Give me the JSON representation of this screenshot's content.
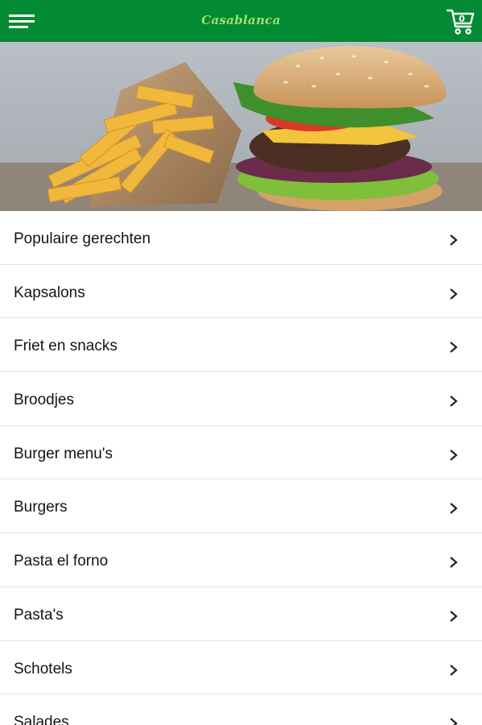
{
  "header": {
    "brand": "Casablanca",
    "cart_count": "0",
    "menu_icon": "hamburger-menu-icon",
    "cart_icon": "shopping-cart-icon"
  },
  "hero": {
    "image": "burger-and-fries-photo"
  },
  "categories": [
    {
      "label": "Populaire gerechten"
    },
    {
      "label": "Kapsalons"
    },
    {
      "label": "Friet en snacks"
    },
    {
      "label": "Broodjes"
    },
    {
      "label": "Burger menu's"
    },
    {
      "label": "Burgers"
    },
    {
      "label": "Pasta el forno"
    },
    {
      "label": "Pasta's"
    },
    {
      "label": "Schotels"
    },
    {
      "label": "Salades"
    }
  ],
  "colors": {
    "header_bg": "#038a33",
    "brand_text": "#9be36c"
  }
}
